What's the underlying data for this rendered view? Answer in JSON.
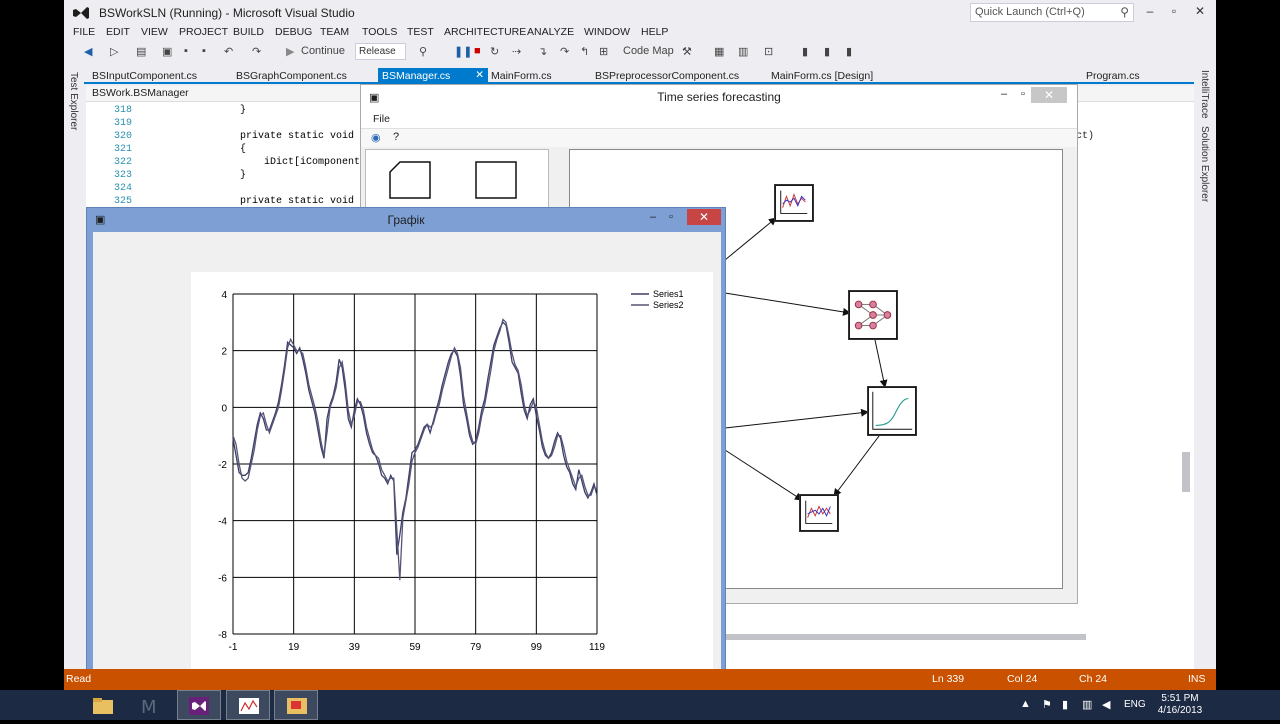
{
  "vs": {
    "title": "BSWorkSLN (Running) - Microsoft Visual Studio",
    "quick_launch": "Quick Launch (Ctrl+Q)",
    "menu": [
      "FILE",
      "EDIT",
      "VIEW",
      "PROJECT",
      "BUILD",
      "DEBUG",
      "TEAM",
      "TOOLS",
      "TEST",
      "ARCHITECTURE",
      "ANALYZE",
      "WINDOW",
      "HELP"
    ],
    "toolbar": {
      "continue_label": "Continue",
      "config_value": "Release",
      "codemap_label": "Code Map"
    },
    "tabs": [
      "BSInputComponent.cs",
      "BSGraphComponent.cs",
      "BSManager.cs",
      "MainForm.cs",
      "BSPreprocessorComponent.cs",
      "MainForm.cs [Design]",
      "Program.cs"
    ],
    "active_tab": "BSManager.cs",
    "left_tools": "Test Explorer",
    "right_tools": [
      "IntelliTrace",
      "Solution Explorer"
    ],
    "breadcrumb": "BSWork.BSManager",
    "code_lines": [
      {
        "n": "318",
        "t": "        }"
      },
      {
        "n": "319",
        "t": ""
      },
      {
        "n": "320",
        "t": "        private static void _AddPredOr"
      },
      {
        "n": "321",
        "t": "        {"
      },
      {
        "n": "322",
        "t": "            iDict[iComponent].Add(iSuc"
      },
      {
        "n": "323",
        "t": "        }"
      },
      {
        "n": "324",
        "t": ""
      },
      {
        "n": "325",
        "t": "        private static void ComponentF"
      }
    ],
    "code_tail": "ct)",
    "status": {
      "left": "Read",
      "ln": "Ln 339",
      "col": "Col 24",
      "ch": "Ch 24",
      "mode": "INS"
    },
    "colors": {
      "accent": "#007acc",
      "status_bar": "#ca5100"
    }
  },
  "ts_window": {
    "title": "Time series forecasting",
    "menu_file": "File"
  },
  "graph_window": {
    "title": "Графік"
  },
  "chart_data": {
    "type": "line",
    "title": "",
    "xlabel": "",
    "ylabel": "",
    "xlim": [
      -1,
      119
    ],
    "ylim": [
      -8,
      4
    ],
    "x_ticks": [
      -1,
      19,
      39,
      59,
      79,
      99,
      119
    ],
    "y_ticks": [
      4,
      2,
      0,
      -2,
      -4,
      -6,
      -8
    ],
    "grid": true,
    "legend": "top-right",
    "series": [
      {
        "name": "Series1",
        "color": "#3d3d6b",
        "values": [
          -1.1,
          -1.7,
          -2.3,
          -2.4,
          -2.4,
          -2.3,
          -1.8,
          -1.2,
          -0.6,
          -0.2,
          -0.4,
          -0.8,
          -0.8,
          -0.5,
          -0.2,
          0.2,
          0.8,
          1.5,
          2.3,
          2.2,
          2.1,
          1.9,
          2.1,
          1.7,
          1.2,
          0.6,
          0.2,
          -0.2,
          -0.8,
          -1.4,
          -1.8,
          -0.4,
          0.1,
          0.4,
          0.9,
          1.7,
          1.4,
          0.6,
          -0.4,
          -0.7,
          -0.1,
          0.3,
          0.1,
          -0.3,
          -0.9,
          -1.3,
          -1.6,
          -1.7,
          -2.0,
          -2.4,
          -2.5,
          -2.7,
          -2.4,
          -2.6,
          -5.2,
          -4.5,
          -3.7,
          -3.2,
          -2.4,
          -1.6,
          -1.5,
          -1.3,
          -1.0,
          -0.7,
          -0.6,
          -0.9,
          -0.5,
          -0.1,
          0.3,
          0.8,
          1.2,
          1.6,
          1.9,
          2.0,
          1.8,
          1.1,
          0.1,
          -0.4,
          -1.0,
          -1.3,
          -1.2,
          -0.7,
          -0.1,
          0.3,
          1.0,
          1.6,
          2.2,
          2.5,
          2.8,
          3.0,
          2.9,
          2.3,
          1.6,
          1.4,
          1.2,
          0.5,
          -0.1,
          -0.4,
          0.1,
          0.3,
          -0.3,
          -0.8,
          -1.4,
          -1.7,
          -1.8,
          -1.6,
          -1.2,
          -0.9,
          -1.1,
          -1.7,
          -2.1,
          -2.3,
          -2.7,
          -2.9,
          -2.2,
          -2.6,
          -3.0,
          -3.2,
          -3.0,
          -2.7,
          -3.1
        ]
      },
      {
        "name": "Series2",
        "color": "#555577",
        "values": [
          -1.0,
          -1.3,
          -2.0,
          -2.5,
          -2.6,
          -2.5,
          -2.0,
          -1.5,
          -0.8,
          -0.3,
          -0.2,
          -0.6,
          -0.9,
          -0.6,
          -0.3,
          0.0,
          0.6,
          1.3,
          2.1,
          2.4,
          2.2,
          2.0,
          2.0,
          1.9,
          1.4,
          0.8,
          0.4,
          0.0,
          -0.5,
          -1.2,
          -1.7,
          -0.9,
          0.0,
          0.3,
          0.7,
          1.4,
          1.6,
          0.9,
          -0.1,
          -0.6,
          -0.3,
          0.2,
          0.2,
          -0.1,
          -0.7,
          -1.1,
          -1.5,
          -1.7,
          -1.8,
          -2.2,
          -2.4,
          -2.6,
          -2.5,
          -2.5,
          -4.3,
          -6.1,
          -3.9,
          -3.3,
          -2.7,
          -1.9,
          -1.6,
          -1.4,
          -1.1,
          -0.8,
          -0.6,
          -0.7,
          -0.6,
          -0.2,
          0.1,
          0.6,
          1.0,
          1.4,
          1.8,
          2.1,
          1.9,
          1.4,
          0.4,
          -0.2,
          -0.8,
          -1.2,
          -1.3,
          -0.9,
          -0.3,
          0.1,
          0.7,
          1.3,
          2.0,
          2.4,
          2.7,
          3.1,
          3.0,
          2.5,
          1.9,
          1.5,
          1.3,
          0.8,
          0.1,
          -0.3,
          -0.1,
          0.2,
          0.0,
          -0.6,
          -1.2,
          -1.6,
          -1.8,
          -1.7,
          -1.4,
          -1.0,
          -1.0,
          -1.4,
          -1.9,
          -2.2,
          -2.5,
          -2.8,
          -2.5,
          -2.4,
          -2.8,
          -3.1,
          -3.1,
          -2.8,
          -2.9
        ]
      }
    ]
  }
}
